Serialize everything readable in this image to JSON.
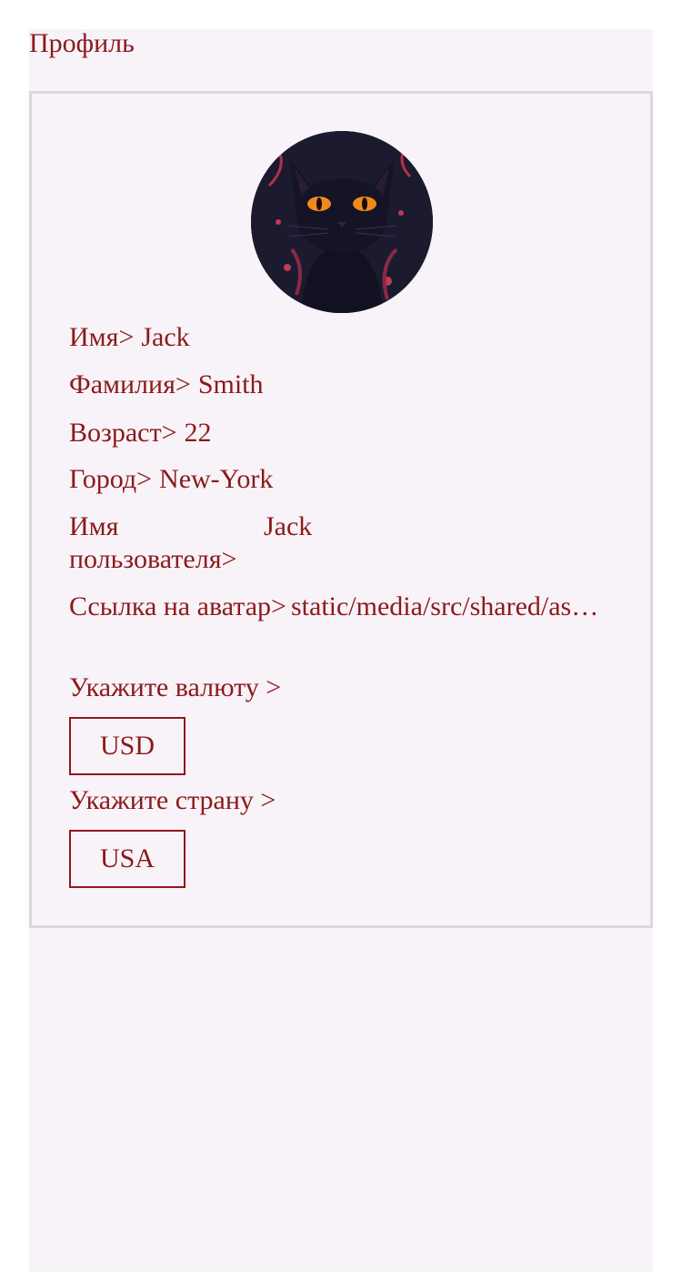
{
  "page": {
    "title": "Профиль"
  },
  "profile": {
    "avatar_icon": "black-cat-avatar",
    "first_name": {
      "label": "Имя>",
      "value": "Jack"
    },
    "last_name": {
      "label": "Фамилия>",
      "value": "Smith"
    },
    "age": {
      "label": "Возраст>",
      "value": "22"
    },
    "city": {
      "label": "Город>",
      "value": "New-York"
    },
    "username": {
      "label": "Имя пользователя>",
      "value": "Jack"
    },
    "avatar_link": {
      "label": "Ссылка на аватар>",
      "value": "static/media/src/shared/assets/tests/storybook.jpg"
    }
  },
  "currency": {
    "label": "Укажите валюту >",
    "selected": "USD"
  },
  "country": {
    "label": "Укажите страну >",
    "selected": "USA"
  },
  "colors": {
    "text": "#8b1a1a",
    "background": "#f8f3f9",
    "card_border": "#dcd6de"
  }
}
